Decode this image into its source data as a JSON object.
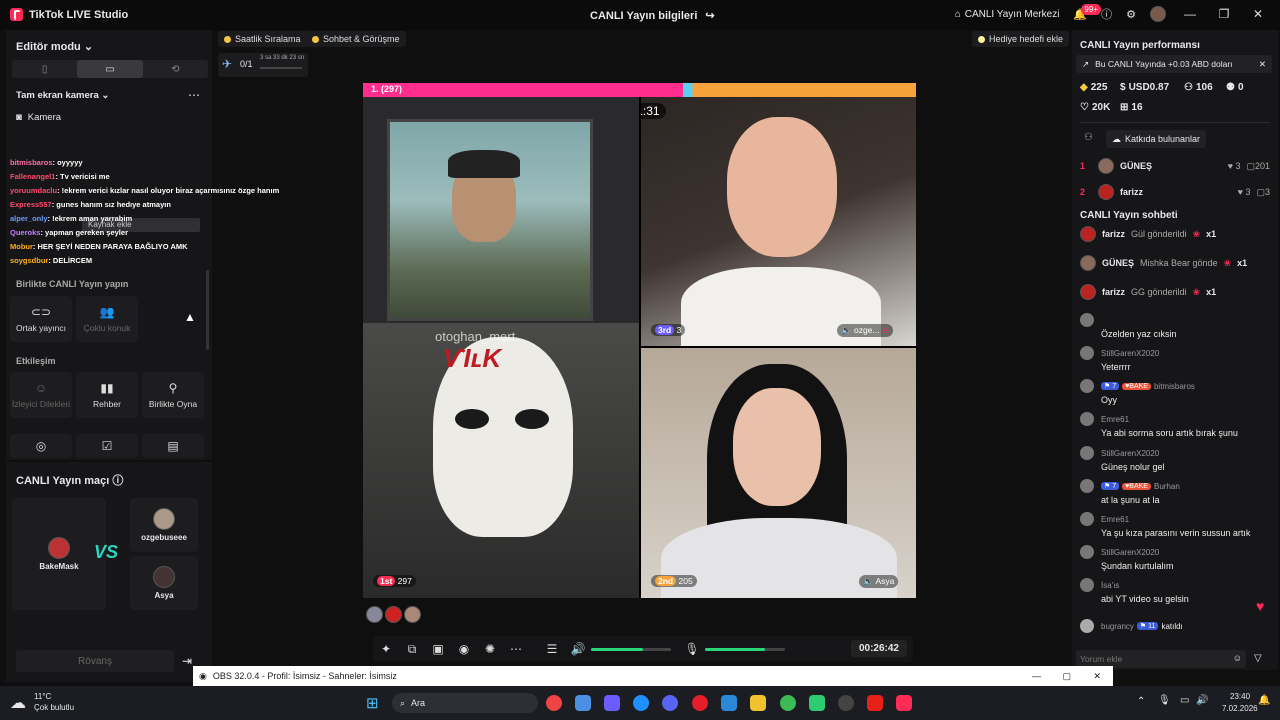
{
  "titlebar": {
    "app_name": "TikTok LIVE Studio",
    "center_title": "CANLI Yayın bilgileri",
    "live_center": "CANLI Yayın Merkezi",
    "notif_count": "99+"
  },
  "left": {
    "editor_mode": "Editör modu",
    "source": "Tam ekran kamera",
    "camera": "Kamera",
    "overlay_tooltip": "Kaynak ekle",
    "chat": [
      {
        "user": "bitmisbaros",
        "msg": ": oyyyyy",
        "color": "#ff6fa8"
      },
      {
        "user": "Fallenangel1",
        "msg": ": Tv vericisi me",
        "color": "#ff4b6e"
      },
      {
        "user": "yoruumdaclu",
        "msg": ": !ekrem verici kızlar nasıl oluyor biraz açarmısınız özge hanım",
        "color": "#ff4b6e"
      },
      {
        "user": "Express557",
        "msg": ": gunes hanım sız hedıye atmayın",
        "color": "#ff4b6e"
      },
      {
        "user": "alper_only",
        "msg": ": !ekrem aman yarrabim",
        "color": "#6b9cff"
      },
      {
        "user": "Queroks",
        "msg": ": yapman gereken şeyler",
        "color": "#c77dff"
      },
      {
        "user": "Mobur",
        "msg": ": HER ŞEYİ NEDEN PARAYA BAĞLIYO AMK",
        "color": "#ffb020"
      },
      {
        "user": "soygsdbur",
        "msg": ": DELİRCEM",
        "color": "#ffb020"
      }
    ],
    "together_title": "Birlikte CANLI Yayın yapın",
    "cohost": "Ortak yayıncı",
    "multi_guest": "Çoklu konuk",
    "interaction_title": "Etkileşim",
    "viewer_wishes": "İzleyici Dilekleri",
    "guide": "Rehber",
    "play_together": "Birlikte Oyna"
  },
  "match": {
    "title": "CANLI Yayın maçı",
    "host": "BakeMask",
    "opponent1": "ozgebuseee",
    "opponent2": "Asya",
    "rematch": "Rövanş"
  },
  "topbar": {
    "hourly": "Saatlik Sıralama",
    "chat_meet": "Sohbet & Görüşme",
    "gift_goal": "Hediye hedefi ekle",
    "goal_progress": "0/1",
    "goal_time": "3 sa 33 dk 23 sn"
  },
  "video": {
    "top_rank": "1. (297)",
    "timer": "01:31",
    "tile_tr_rank": "3rd",
    "tile_tr_score": "3",
    "tile_tr_name": "ozge...",
    "tile_bl_rank": "1st",
    "tile_bl_score": "297",
    "tile_br_rank": "2nd",
    "tile_br_score": "205",
    "tile_br_name": "Asya",
    "watermark": "otoghan_mert"
  },
  "controls": {
    "elapsed": "00:26:42",
    "volume": 0.65,
    "mic": 0.75
  },
  "right": {
    "perf_title": "CANLI Yayın performansı",
    "earn_note": "Bu CANLI Yayında +0.03 ABD doları",
    "coins": "225",
    "usd": "USD0.87",
    "followers": "106",
    "shares": "0",
    "likes": "20K",
    "gifts": "16",
    "contributors_btn": "Katkıda bulunanlar",
    "contributors": [
      {
        "rank": "1",
        "name": "GÜNEŞ",
        "hearts": "3",
        "score": "201"
      },
      {
        "rank": "2",
        "name": "farizz",
        "hearts": "3",
        "score": "3"
      }
    ],
    "chat_title": "CANLI Yayın sohbeti",
    "gifts_list": [
      {
        "name": "farizz",
        "text": "Gül gönderildi",
        "count": "x1"
      },
      {
        "name": "GÜNEŞ",
        "text": "Mishka Bear gönde",
        "count": "x1"
      },
      {
        "name": "farizz",
        "text": "GG gönderildi",
        "count": "x1"
      }
    ],
    "messages": [
      {
        "name": "",
        "text": "Özelden yaz cıksin"
      },
      {
        "name": "StillGarenX2020",
        "text": "Yeterrrr"
      },
      {
        "name": "bitmisbaros",
        "text": "Oyy"
      },
      {
        "name": "Emre61",
        "text": "Ya abi sorma soru artık bırak şunu"
      },
      {
        "name": "StillGarenX2020",
        "text": "Güneş nolur gel"
      },
      {
        "name": "Burhan",
        "text": "at la şunu at la"
      },
      {
        "name": "Emre61",
        "text": "Ya şu kıza parasını verin sussun artık"
      },
      {
        "name": "StillGarenX2020",
        "text": "Şundan kurtulalım"
      },
      {
        "name": "İsa'ıs",
        "text": "abi YT video su gelsin"
      }
    ],
    "joined_name": "bugrancy",
    "joined_level": "11",
    "joined_text": "katıldı",
    "comment_placeholder": "Yorum ekle",
    "tag_level": "7",
    "tag_bake": "BAKE"
  },
  "obs": {
    "title": "OBS 32.0.4 - Profil: İsimsiz - Sahneler: İsimsiz"
  },
  "taskbar": {
    "temp": "11°C",
    "weather": "Çok bulutlu",
    "search": "Ara",
    "time": "23:40",
    "date": "7.02.2026"
  }
}
